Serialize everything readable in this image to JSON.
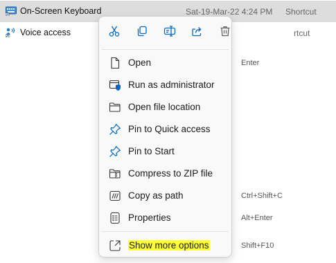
{
  "files": [
    {
      "name": "On-Screen Keyboard",
      "date": "Sat-19-Mar-22 4:24 PM",
      "type": "Shortcut",
      "icon": "keyboard-icon"
    },
    {
      "name": "Voice access",
      "date": "",
      "type": "rtcut",
      "icon": "voice-access-icon"
    }
  ],
  "toolbar": [
    {
      "name": "cut-button",
      "icon": "scissors-icon"
    },
    {
      "name": "copy-button",
      "icon": "copy-icon"
    },
    {
      "name": "rename-button",
      "icon": "rename-icon"
    },
    {
      "name": "share-button",
      "icon": "share-icon"
    },
    {
      "name": "delete-button",
      "icon": "trash-icon"
    }
  ],
  "menu": {
    "items": [
      {
        "label": "Open",
        "shortcut": "Enter",
        "icon": "file-icon"
      },
      {
        "label": "Run as administrator",
        "shortcut": "",
        "icon": "shield-window-icon"
      },
      {
        "label": "Open file location",
        "shortcut": "",
        "icon": "folder-icon"
      },
      {
        "label": "Pin to Quick access",
        "shortcut": "",
        "icon": "pin-icon"
      },
      {
        "label": "Pin to Start",
        "shortcut": "",
        "icon": "pin-icon"
      },
      {
        "label": "Compress to ZIP file",
        "shortcut": "",
        "icon": "zip-folder-icon"
      },
      {
        "label": "Copy as path",
        "shortcut": "Ctrl+Shift+C",
        "icon": "copy-path-icon"
      },
      {
        "label": "Properties",
        "shortcut": "Alt+Enter",
        "icon": "properties-icon"
      }
    ],
    "more": {
      "label": "Show more options",
      "shortcut": "Shift+F10",
      "icon": "more-options-icon"
    }
  },
  "colors": {
    "accent": "#0067c0",
    "highlight": "#ffff33",
    "selection": "#dddddd"
  }
}
